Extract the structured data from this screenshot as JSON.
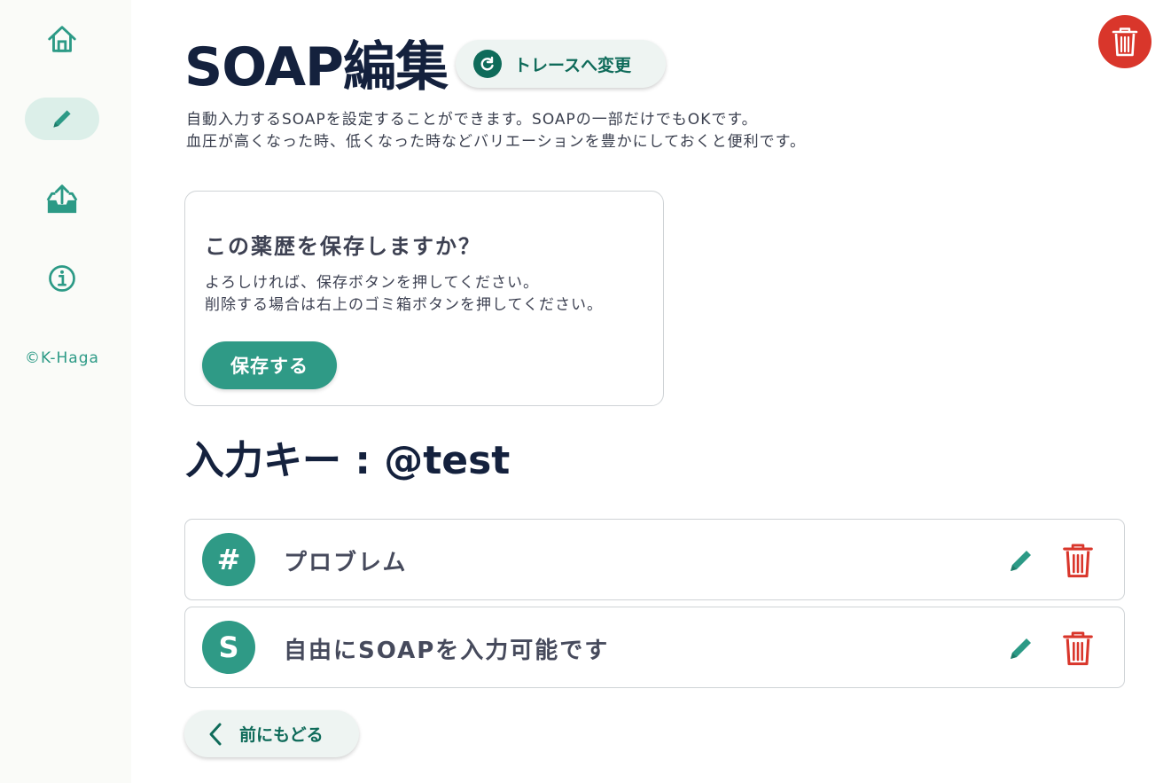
{
  "sidebar": {
    "items": [
      {
        "name": "home",
        "icon": "home-icon",
        "active": false
      },
      {
        "name": "edit",
        "icon": "pencil-icon",
        "active": true
      },
      {
        "name": "upload",
        "icon": "upload-tray-icon",
        "active": false
      },
      {
        "name": "info",
        "icon": "info-icon",
        "active": false
      }
    ],
    "copyright": "©K-Haga"
  },
  "header": {
    "title": "SOAP編集",
    "trace_button": "トレースへ変更",
    "description_line1": "自動入力するSOAPを設定することができます。SOAPの一部だけでもOKです。",
    "description_line2": "血圧が高くなった時、低くなった時などバリエーションを豊かにしておくと便利です。",
    "delete_icon": "trash-icon"
  },
  "confirm_card": {
    "title": "この薬歴を保存しますか？",
    "message_line1": "よろしければ、保存ボタンを押してください。",
    "message_line2": "削除する場合は右上のゴミ箱ボタンを押してください。",
    "save_button": "保存する"
  },
  "input_key": {
    "heading": "入力キー : @test"
  },
  "entries": [
    {
      "badge": "#",
      "text": "プロブレム"
    },
    {
      "badge": "S",
      "text": "自由にSOAPを入力可能です"
    }
  ],
  "back_button": "前にもどる",
  "colors": {
    "accent": "#2f9a86",
    "accent_dark": "#0f6b5a",
    "danger": "#d9362b",
    "title": "#14213d"
  }
}
